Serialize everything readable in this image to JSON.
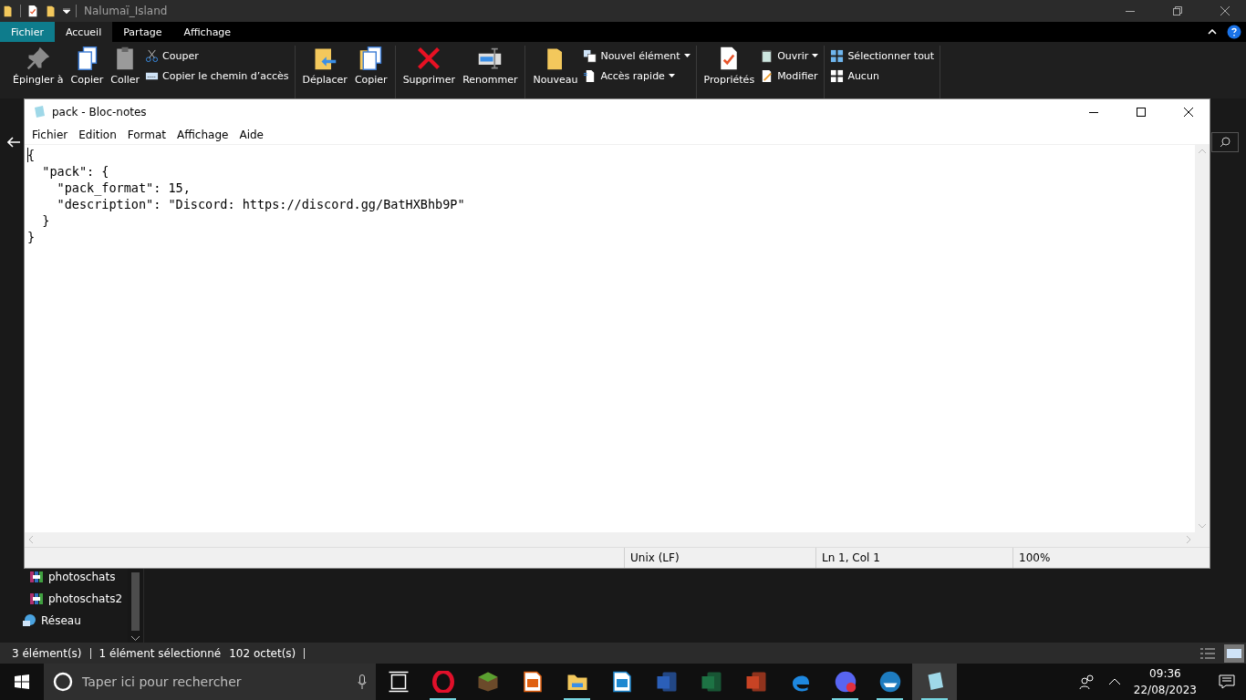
{
  "explorer": {
    "title": "Nalumaï_Island",
    "tabs": [
      {
        "label": "Fichier",
        "kind": "menu",
        "selected": false
      },
      {
        "label": "Accueil",
        "kind": "tab",
        "selected": true
      },
      {
        "label": "Partage",
        "kind": "tab",
        "selected": false
      },
      {
        "label": "Affichage",
        "kind": "tab",
        "selected": false
      }
    ],
    "ribbon": [
      {
        "large": [
          {
            "kind": "pin",
            "lines": [
              "Épingler à"
            ]
          },
          {
            "kind": "copy",
            "lines": [
              "Copier"
            ]
          },
          {
            "kind": "paste",
            "lines": [
              "Coller"
            ]
          }
        ],
        "small": [
          {
            "kind": "scissors",
            "label": "Couper",
            "dropdown": false
          },
          {
            "kind": "path",
            "label": "Copier le chemin d’accès",
            "dropdown": false
          }
        ]
      },
      {
        "large": [
          {
            "kind": "move",
            "lines": [
              "Déplacer"
            ]
          },
          {
            "kind": "copyto",
            "lines": [
              "Copier"
            ]
          }
        ]
      },
      {
        "large": [
          {
            "kind": "delete",
            "lines": [
              "Supprimer"
            ]
          },
          {
            "kind": "rename",
            "lines": [
              "Renommer"
            ]
          }
        ]
      },
      {
        "large": [
          {
            "kind": "folder",
            "lines": [
              "Nouveau"
            ]
          }
        ],
        "small": [
          {
            "kind": "newitem",
            "label": "Nouvel élément",
            "dropdown": true
          },
          {
            "kind": "easy",
            "label": "Accès rapide",
            "dropdown": true
          }
        ]
      },
      {
        "large": [
          {
            "kind": "properties",
            "lines": [
              "Propriétés"
            ]
          }
        ],
        "small": [
          {
            "kind": "open",
            "label": "Ouvrir",
            "dropdown": true
          },
          {
            "kind": "edit",
            "label": "Modifier",
            "dropdown": false
          }
        ]
      },
      {
        "small": [
          {
            "kind": "selectall",
            "label": "Sélectionner tout",
            "dropdown": false
          },
          {
            "kind": "none",
            "label": "Aucun",
            "dropdown": false
          }
        ]
      }
    ],
    "nav_items": [
      {
        "kind": "archive",
        "label": "photoschats"
      },
      {
        "kind": "archive",
        "label": "photoschats2"
      },
      {
        "kind": "network",
        "label": "Réseau"
      }
    ],
    "status": [
      "3 élément(s)",
      "1 élément sélectionné",
      "102 octet(s)"
    ]
  },
  "notepad": {
    "title": "pack - Bloc-notes",
    "menu": [
      "Fichier",
      "Edition",
      "Format",
      "Affichage",
      "Aide"
    ],
    "lines": [
      "{",
      "  \"pack\": {",
      "    \"pack_format\": 15,",
      "    \"description\": \"Discord: https://discord.gg/BatHXBhb9P\"",
      "  }",
      "}"
    ],
    "status": [
      "Unix (LF)",
      "Ln 1, Col 1",
      "100%"
    ]
  },
  "taskbar": {
    "search_placeholder": "Taper ici pour rechercher",
    "apps": [
      {
        "kind": "taskview",
        "running": false,
        "active": false
      },
      {
        "kind": "opera",
        "running": true,
        "active": false
      },
      {
        "kind": "minecraft",
        "running": false,
        "active": false
      },
      {
        "kind": "impress",
        "running": false,
        "active": false
      },
      {
        "kind": "explorer",
        "running": true,
        "active": false
      },
      {
        "kind": "writer",
        "running": false,
        "active": false
      },
      {
        "kind": "word",
        "running": false,
        "active": false
      },
      {
        "kind": "excel",
        "running": false,
        "active": false
      },
      {
        "kind": "powerpoint",
        "running": false,
        "active": false
      },
      {
        "kind": "edge",
        "running": false,
        "active": false
      },
      {
        "kind": "discord",
        "running": true,
        "active": false
      },
      {
        "kind": "boat",
        "running": true,
        "active": false
      },
      {
        "kind": "notepad",
        "running": true,
        "active": true
      }
    ],
    "time": "09:36",
    "date": "22/08/2023"
  }
}
